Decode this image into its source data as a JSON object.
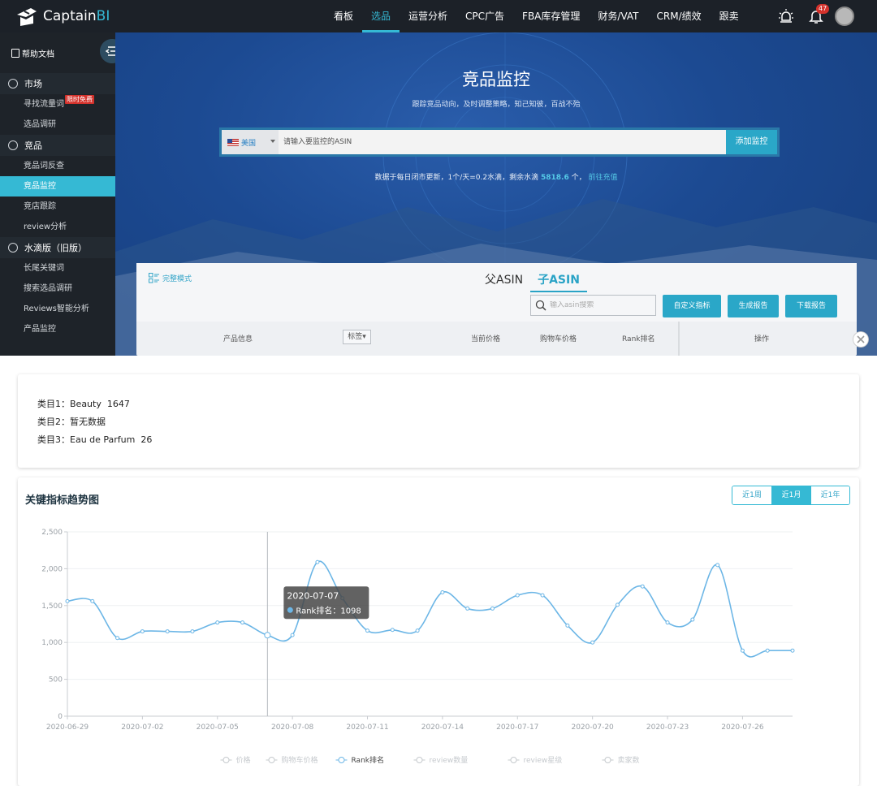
{
  "brand": {
    "name_main": "Captain",
    "name_accent": "BI"
  },
  "nav": {
    "items": [
      "看板",
      "选品",
      "运营分析",
      "CPC广告",
      "FBA库存管理",
      "财务/VAT",
      "CRM/绩效",
      "跟卖"
    ],
    "active_index": 1,
    "notification_count": "47",
    "accent_color": "#35b9d4"
  },
  "sidebar": {
    "help_label": "帮助文档",
    "sections": [
      {
        "label": "市场",
        "items": [
          {
            "label": "寻找流量词",
            "tag": "限时免费"
          },
          {
            "label": "选品调研"
          }
        ]
      },
      {
        "label": "竞品",
        "items": [
          {
            "label": "竞品词反查"
          },
          {
            "label": "竞品监控",
            "active": true
          },
          {
            "label": "竞店跟踪"
          },
          {
            "label": "review分析"
          }
        ]
      },
      {
        "label": "水滴版（旧版）",
        "items": [
          {
            "label": "长尾关键词"
          },
          {
            "label": "搜索选品调研"
          },
          {
            "label": "Reviews智能分析"
          },
          {
            "label": "产品监控"
          }
        ]
      }
    ]
  },
  "hero": {
    "title": "竞品监控",
    "subtitle": "跟踪竞品动向，及时调整策略，知己知彼，百战不殆",
    "country": "美国",
    "asin_placeholder": "请输入要监控的ASIN",
    "add_button": "添加监控",
    "info_prefix": "数据于每日闭市更新，1个/天=0.2水滴，剩余水滴",
    "info_value": "5818.6",
    "info_suffix": "个，",
    "info_link": "前往充值"
  },
  "table": {
    "mode_label": "完整模式",
    "tabs": [
      "父ASIN",
      "子ASIN"
    ],
    "active_tab": 1,
    "search_placeholder": "输入asin搜索",
    "buttons": [
      "自定义指标",
      "生成报告",
      "下载报告"
    ],
    "columns": [
      "产品信息",
      "标签▾",
      "当前价格",
      "购物车价格",
      "Rank排名",
      "操作"
    ]
  },
  "categories": [
    {
      "label": "类目1：",
      "name": "Beauty",
      "rank": "1647"
    },
    {
      "label": "类目2：",
      "name": "暂无数据",
      "rank": ""
    },
    {
      "label": "类目3：",
      "name": "Eau de Parfum",
      "rank": "26"
    }
  ],
  "chart_panel": {
    "title": "关键指标趋势图",
    "ranges": [
      "近1周",
      "近1月",
      "近1年"
    ],
    "active_range": 1
  },
  "chart_data": {
    "type": "line",
    "x": [
      "2020-06-29",
      "2020-06-30",
      "2020-07-01",
      "2020-07-02",
      "2020-07-03",
      "2020-07-04",
      "2020-07-05",
      "2020-07-06",
      "2020-07-07",
      "2020-07-08",
      "2020-07-09",
      "2020-07-10",
      "2020-07-11",
      "2020-07-12",
      "2020-07-13",
      "2020-07-14",
      "2020-07-15",
      "2020-07-16",
      "2020-07-17",
      "2020-07-18",
      "2020-07-19",
      "2020-07-20",
      "2020-07-21",
      "2020-07-22",
      "2020-07-23",
      "2020-07-24",
      "2020-07-25",
      "2020-07-26",
      "2020-07-27",
      "2020-07-28"
    ],
    "xticks": [
      "2020-06-29",
      "2020-07-02",
      "2020-07-05",
      "2020-07-08",
      "2020-07-11",
      "2020-07-14",
      "2020-07-17",
      "2020-07-20",
      "2020-07-23",
      "2020-07-26"
    ],
    "series": [
      {
        "name": "Rank排名",
        "color": "#6cb6e6",
        "values": [
          1560,
          1560,
          1060,
          1150,
          1150,
          1150,
          1270,
          1270,
          1098,
          1100,
          2090,
          1600,
          1160,
          1170,
          1160,
          1680,
          1460,
          1460,
          1640,
          1640,
          1230,
          1000,
          1510,
          1760,
          1270,
          1310,
          2050,
          890,
          890,
          890
        ]
      }
    ],
    "ylim": [
      0,
      2500
    ],
    "yticks": [
      0,
      500,
      1000,
      1500,
      2000,
      2500
    ],
    "legend": [
      "价格",
      "购物车价格",
      "Rank排名",
      "review数量",
      "review星级",
      "卖家数"
    ],
    "legend_active": "Rank排名",
    "legend_position": "bottom-center",
    "grid": true,
    "tooltip": {
      "date": "2020-07-07",
      "label": "Rank排名：1098",
      "index": 8
    }
  }
}
